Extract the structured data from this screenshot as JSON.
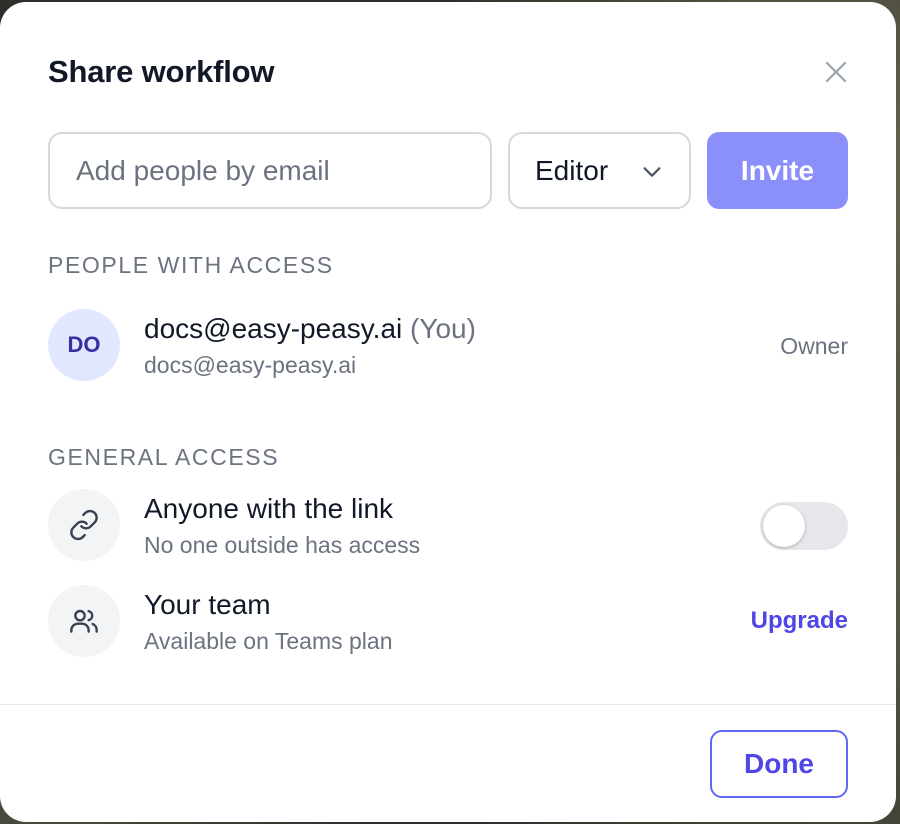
{
  "dialog": {
    "title": "Share workflow",
    "close_icon": "close-icon"
  },
  "invite": {
    "email_placeholder": "Add people by email",
    "email_value": "",
    "role_selected": "Editor",
    "invite_label": "Invite"
  },
  "people_section": {
    "heading": "PEOPLE WITH ACCESS",
    "people": [
      {
        "initials": "DO",
        "name": "docs@easy-peasy.ai",
        "you_label": "(You)",
        "email": "docs@easy-peasy.ai",
        "role": "Owner"
      }
    ]
  },
  "general_section": {
    "heading": "GENERAL ACCESS",
    "link_access": {
      "icon": "link-icon",
      "title": "Anyone with the link",
      "subtitle": "No one outside has access",
      "enabled": false
    },
    "team_access": {
      "icon": "users-icon",
      "title": "Your team",
      "subtitle": "Available on Teams plan",
      "action_label": "Upgrade"
    }
  },
  "footer": {
    "done_label": "Done"
  },
  "colors": {
    "accent": "#4f46e5",
    "invite_button": "#8b8ff9",
    "avatar_bg": "#e0e7ff",
    "muted_text": "#6b7280"
  }
}
